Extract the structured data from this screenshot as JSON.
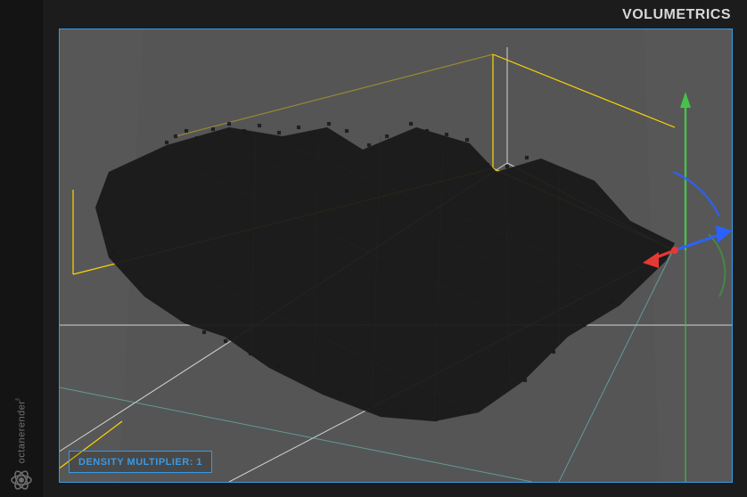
{
  "app": {
    "brand_label": "octanerender",
    "brand_tm": "™"
  },
  "panel": {
    "title": "VOLUMETRICS",
    "badge_label": "DENSITY MULTIPLIER: 1"
  },
  "viewport": {
    "border_color": "#379ae6",
    "background_color": "#555555",
    "gizmo": {
      "axis_x_color": "#e53935",
      "axis_y_color": "#4caf50",
      "axis_z_color": "#2962ff"
    },
    "guides": {
      "bounding_color": "#ffd600",
      "grid_color": "#ffffff",
      "user_color": "#6fd1cf"
    }
  }
}
